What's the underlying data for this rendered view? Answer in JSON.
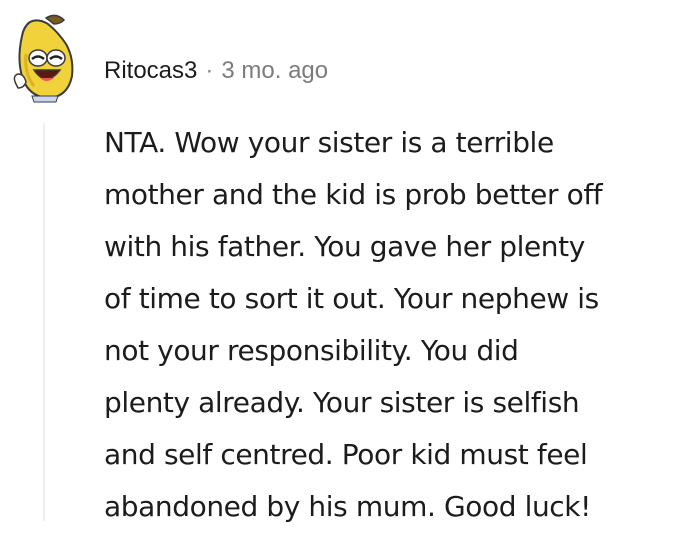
{
  "comment": {
    "username": "Ritocas3",
    "separator": "·",
    "timestamp": "3 mo. ago",
    "avatar_icon": "banana-avatar-icon",
    "body_lines": [
      "NTA. Wow your sister is a terrible",
      "mother and the kid is prob better off",
      "with his father. You gave her plenty",
      "of time to sort it out. Your nephew is",
      "not your responsibility. You did",
      "plenty already. Your sister is selfish",
      "and self centred. Poor kid must feel",
      "abandoned by his mum. Good luck!"
    ]
  },
  "colors": {
    "text": "#1c1c1c",
    "meta": "#7c7c7c",
    "thread_line": "#edeff1",
    "avatar_yellow": "#f2d23b"
  }
}
